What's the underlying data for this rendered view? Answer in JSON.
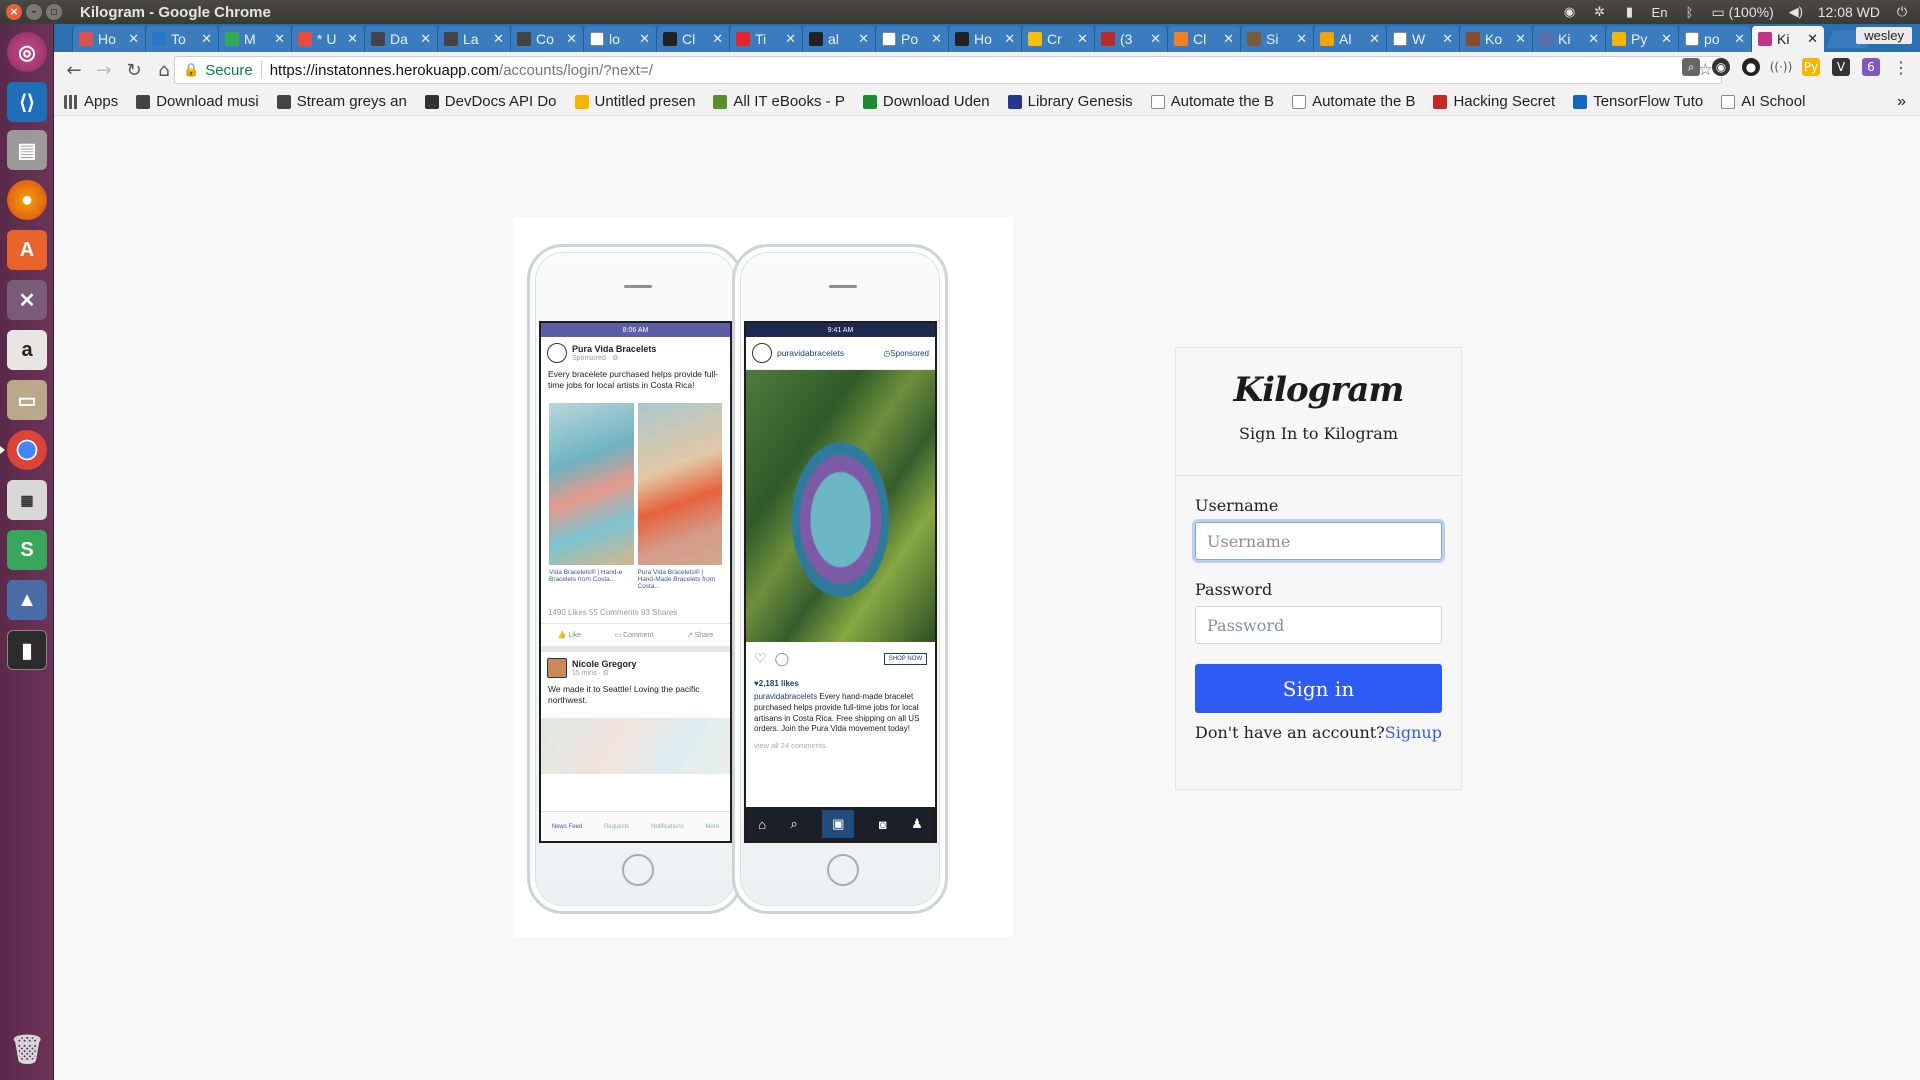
{
  "window": {
    "title": "Kilogram - Google Chrome",
    "tray": {
      "battery": "(100%)",
      "clock": "12:08 WD",
      "user": "wesley"
    }
  },
  "tabs": [
    {
      "title": "Ho",
      "color": "#d9534f"
    },
    {
      "title": "To",
      "color": "#2a79c9"
    },
    {
      "title": "M",
      "color": "#34a853"
    },
    {
      "title": "* U",
      "color": "#e84d3c"
    },
    {
      "title": "Da",
      "color": "#444444"
    },
    {
      "title": "La",
      "color": "#444444"
    },
    {
      "title": "Co",
      "color": "#444444"
    },
    {
      "title": "lo",
      "color": "#ffffff"
    },
    {
      "title": "Cl",
      "color": "#222222"
    },
    {
      "title": "Ti",
      "color": "#e0252e"
    },
    {
      "title": "al",
      "color": "#222222"
    },
    {
      "title": "Po",
      "color": "#ffffff"
    },
    {
      "title": "Ho",
      "color": "#222222"
    },
    {
      "title": "Cr",
      "color": "#f4c20d"
    },
    {
      "title": "(3",
      "color": "#b92b27"
    },
    {
      "title": "Cl",
      "color": "#f48024"
    },
    {
      "title": "Si",
      "color": "#7a5c3b"
    },
    {
      "title": "Al",
      "color": "#f0a500"
    },
    {
      "title": "W",
      "color": "#ffffff"
    },
    {
      "title": "Ko",
      "color": "#8a4b2a"
    },
    {
      "title": "Ki",
      "color": "#5b6ea8"
    },
    {
      "title": "Py",
      "color": "#f2b705"
    },
    {
      "title": "po",
      "color": "#ffffff"
    },
    {
      "title": "Ki",
      "color": "#c13584",
      "active": true
    }
  ],
  "omnibox": {
    "secure_label": "Secure",
    "url_host": "https://instatonnes.herokuapp.com",
    "url_path": "/accounts/login/?next=/"
  },
  "bookmarks": [
    {
      "label": "Apps",
      "color": "#555555"
    },
    {
      "label": "Download musi",
      "color": "#444444"
    },
    {
      "label": "Stream greys an",
      "color": "#444444"
    },
    {
      "label": "DevDocs API Do",
      "color": "#333333"
    },
    {
      "label": "Untitled presen",
      "color": "#f4b400"
    },
    {
      "label": "All IT eBooks - P",
      "color": "#5a8f2e"
    },
    {
      "label": "Download Uden",
      "color": "#1e8c2c"
    },
    {
      "label": "Library Genesis",
      "color": "#283593"
    },
    {
      "label": "Automate the B",
      "color": "#ffffff"
    },
    {
      "label": "Automate the B",
      "color": "#ffffff"
    },
    {
      "label": "Hacking Secret",
      "color": "#c62828"
    },
    {
      "label": "TensorFlow Tuto",
      "color": "#1565c0"
    },
    {
      "label": "AI School",
      "color": "#ffffff"
    }
  ],
  "bookmarks_overflow": "»",
  "facebook_phone": {
    "status_time": "8:06 AM",
    "page_name": "Pura Vida Bracelets",
    "sponsored": "Sponsored · ⚙",
    "post_text": "Every bracelete purchased helps provide full-time jobs for local artists in Costa Rica!",
    "caption_a": "Vida Bracelets® | Hand-e Bracelets from Costa...",
    "caption_b": "Pura Vida Bracelets® | Hand-Made Bracelets from Costa...",
    "stats": "1490 Likes  55 Comments 93 Shares",
    "like": "Like",
    "comment": "Comment",
    "share": "Share",
    "comment_user": "Nicole Gregory",
    "comment_time": "15 mins · ⚙",
    "comment_text": "We made it to Seattle! Loving the pacific northwest.",
    "tab_newsfeed": "News Feed",
    "tab_requests": "Requests",
    "tab_notifications": "Notifications",
    "tab_more": "More"
  },
  "instagram_phone": {
    "status_time": "9:41 AM",
    "account": "puravidabracelets",
    "sponsored": "Sponsored",
    "shop_now": "SHOP NOW",
    "likes": "♥2,181 likes",
    "caption_user": "puravidabracelets",
    "caption_text": " Every hand-made bracelet purchased helps provide full-time jobs for local artisans in Costa Rica. Free shipping on all US orders. Join the Pura Vida movement today!",
    "view_comments": "view all 24 comments"
  },
  "login": {
    "brand": "Kilogram",
    "subtitle": "Sign In to Kilogram",
    "username_label": "Username",
    "username_placeholder": "Username",
    "password_label": "Password",
    "password_placeholder": "Password",
    "signin_label": "Sign in",
    "no_account_text": "Don't have an account?",
    "signup_link": "Signup",
    "accent_color": "#2f5bf5"
  }
}
